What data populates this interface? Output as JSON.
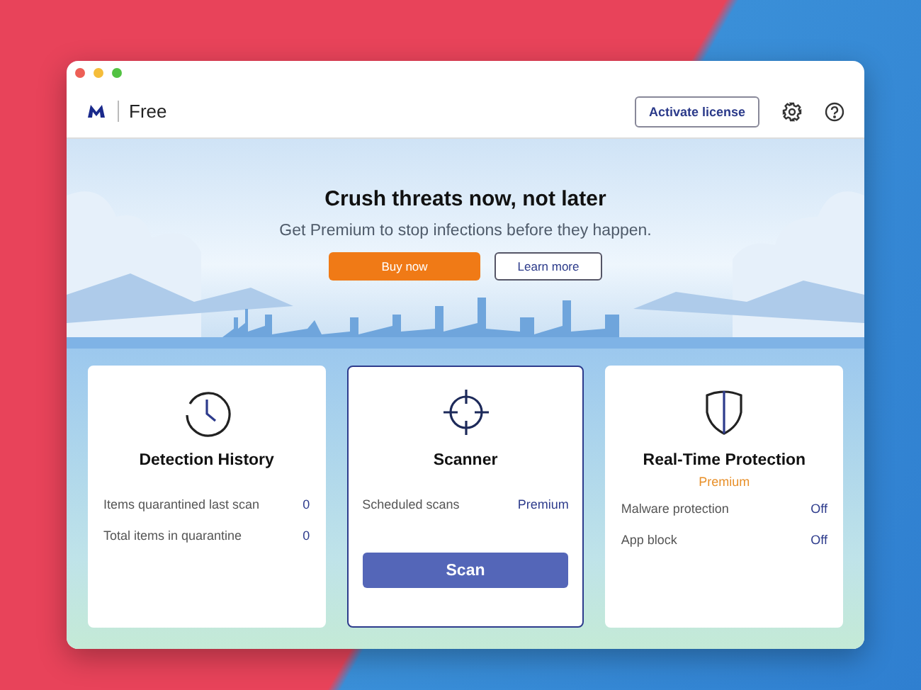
{
  "header": {
    "edition": "Free",
    "activate_button": "Activate license"
  },
  "banner": {
    "title": "Crush threats now, not later",
    "subtitle": "Get Premium to stop infections before they happen.",
    "buy_button": "Buy now",
    "learn_button": "Learn more"
  },
  "cards": [
    {
      "kind": "history",
      "title": "Detection History",
      "selected": false,
      "rows": [
        {
          "label": "Items quarantined last scan",
          "value": "0"
        },
        {
          "label": "Total items in quarantine",
          "value": "0"
        }
      ]
    },
    {
      "kind": "scanner",
      "title": "Scanner",
      "selected": true,
      "rows": [
        {
          "label": "Scheduled scans",
          "value": "Premium"
        }
      ],
      "button": "Scan"
    },
    {
      "kind": "protection",
      "title": "Real-Time Protection",
      "subtitle": "Premium",
      "selected": false,
      "rows": [
        {
          "label": "Malware protection",
          "value": "Off"
        },
        {
          "label": "App block",
          "value": "Off"
        }
      ]
    }
  ]
}
